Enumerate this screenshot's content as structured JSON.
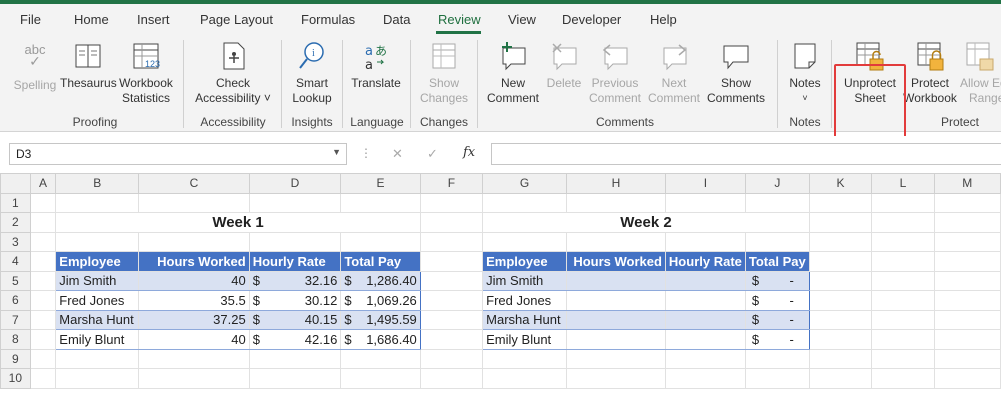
{
  "tabs": [
    "File",
    "Home",
    "Insert",
    "Page Layout",
    "Formulas",
    "Data",
    "Review",
    "View",
    "Developer",
    "Help"
  ],
  "active_tab": "Review",
  "ribbon": {
    "spelling": {
      "icon_text": "abc",
      "label": "Spelling"
    },
    "thesaurus": "Thesaurus",
    "workbook_statistics": [
      "Workbook",
      "Statistics"
    ],
    "proofing": "Proofing",
    "check_accessibility": [
      "Check",
      "Accessibility ˅"
    ],
    "accessibility": "Accessibility",
    "smart_lookup": [
      "Smart",
      "Lookup"
    ],
    "insights": "Insights",
    "translate": "Translate",
    "language": "Language",
    "show_changes": [
      "Show",
      "Changes"
    ],
    "changes": "Changes",
    "new_comment": [
      "New",
      "Comment"
    ],
    "delete": "Delete",
    "previous_comment": [
      "Previous",
      "Comment"
    ],
    "next_comment": [
      "Next",
      "Comment"
    ],
    "show_comments": [
      "Show",
      "Comments"
    ],
    "comments": "Comments",
    "notes": "Notes",
    "notes_group": "Notes",
    "unprotect_sheet": [
      "Unprotect",
      "Sheet"
    ],
    "protect_workbook": [
      "Protect",
      "Workbook"
    ],
    "allow_edit_ranges": [
      "Allow Ed",
      "Range"
    ],
    "protect": "Protect",
    "accent_color": "#217346",
    "highlight_color": "#e23b3b"
  },
  "formula_bar": {
    "name_box": "D3",
    "fx": "fx",
    "cancel": "✕",
    "enter": "✓",
    "dots": "⋮",
    "value": ""
  },
  "columns": [
    "A",
    "B",
    "C",
    "D",
    "E",
    "F",
    "G",
    "H",
    "I",
    "J",
    "K",
    "L",
    "M"
  ],
  "rows": [
    "1",
    "2",
    "3",
    "4",
    "5",
    "6",
    "7",
    "8",
    "9",
    "10"
  ],
  "week1": {
    "title": "Week 1",
    "headers": [
      "Employee",
      "Hours Worked",
      "Hourly Rate",
      "Total Pay"
    ],
    "rows": [
      {
        "employee": "Jim Smith",
        "hours": "40",
        "rate_sym": "$",
        "rate": "32.16",
        "pay_sym": "$",
        "pay": "1,286.40"
      },
      {
        "employee": "Fred Jones",
        "hours": "35.5",
        "rate_sym": "$",
        "rate": "30.12",
        "pay_sym": "$",
        "pay": "1,069.26"
      },
      {
        "employee": "Marsha Hunt",
        "hours": "37.25",
        "rate_sym": "$",
        "rate": "40.15",
        "pay_sym": "$",
        "pay": "1,495.59"
      },
      {
        "employee": "Emily Blunt",
        "hours": "40",
        "rate_sym": "$",
        "rate": "42.16",
        "pay_sym": "$",
        "pay": "1,686.40"
      }
    ]
  },
  "week2": {
    "title": "Week 2",
    "headers": [
      "Employee",
      "Hours Worked",
      "Hourly Rate",
      "Total Pay"
    ],
    "rows": [
      {
        "employee": "Jim Smith",
        "pay_sym": "$",
        "pay": "-"
      },
      {
        "employee": "Fred Jones",
        "pay_sym": "$",
        "pay": "-"
      },
      {
        "employee": "Marsha Hunt",
        "pay_sym": "$",
        "pay": "-"
      },
      {
        "employee": "Emily Blunt",
        "pay_sym": "$",
        "pay": "-"
      }
    ]
  },
  "colors": {
    "table_header": "#4472c4",
    "table_band": "#d9e1f2"
  }
}
